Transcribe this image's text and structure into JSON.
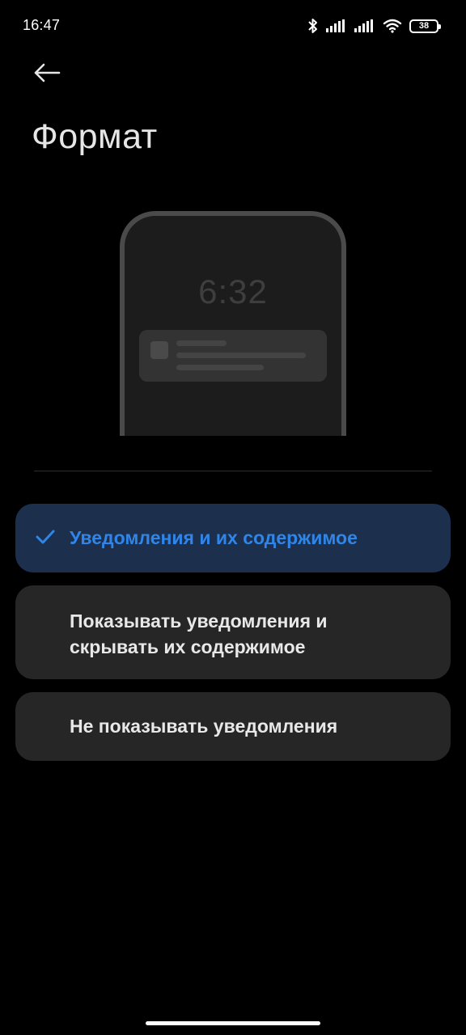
{
  "status_bar": {
    "time": "16:47",
    "battery_level": "38",
    "icons": [
      "bluetooth-icon",
      "signal-icon",
      "signal-icon",
      "wifi-icon",
      "battery-icon"
    ]
  },
  "header": {
    "back_icon": "arrow-left-icon",
    "title": "Формат"
  },
  "preview": {
    "clock": "6:32"
  },
  "options": [
    {
      "label": "Уведомления и их содержимое",
      "selected": true
    },
    {
      "label": "Показывать уведомления и скрывать их содержимое",
      "selected": false
    },
    {
      "label": "Не показывать уведомления",
      "selected": false
    }
  ],
  "colors": {
    "background": "#000000",
    "card": "#262626",
    "selected_card": "#1c2f4d",
    "accent": "#2f86e8",
    "text": "#e8e8e8"
  }
}
